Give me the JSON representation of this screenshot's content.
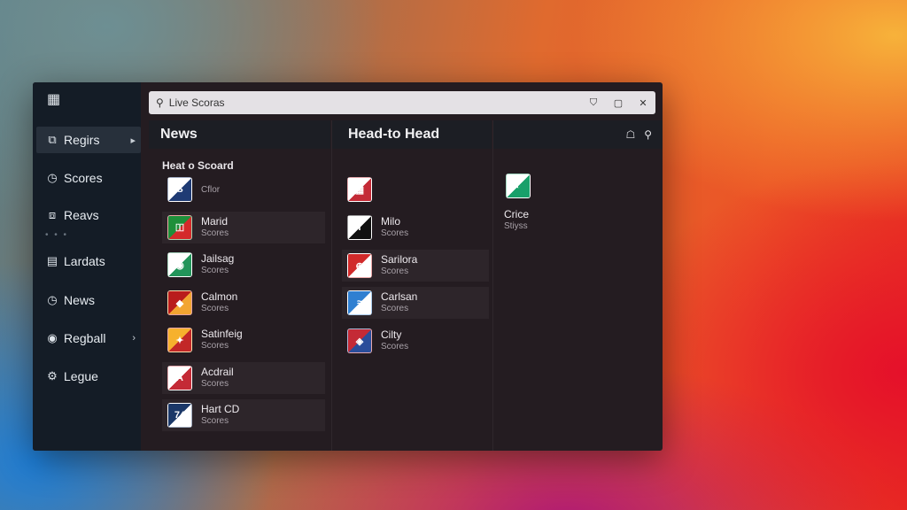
{
  "search": {
    "title": "Live Scoras"
  },
  "window_controls": {
    "pin": "⛉",
    "maximize": "▢",
    "close": "✕"
  },
  "sidebar": {
    "items": [
      {
        "label": "Regirs",
        "icon": "grid-icon",
        "glyph": "⧉",
        "active": true,
        "chevron": "▸"
      },
      {
        "label": "Scores",
        "icon": "clock-icon",
        "glyph": "◷"
      },
      {
        "label": "Reavs",
        "icon": "chart-icon",
        "glyph": "⧈"
      },
      {
        "label": "Lardats",
        "icon": "list-icon",
        "glyph": "▤"
      },
      {
        "label": "News",
        "icon": "clock-icon",
        "glyph": "◷"
      },
      {
        "label": "Regball",
        "icon": "globe-icon",
        "glyph": "◉",
        "chevron": "›"
      },
      {
        "label": "Legue",
        "icon": "settings-icon",
        "glyph": "⚙"
      }
    ],
    "dots": "• • •"
  },
  "panels": {
    "news": {
      "title": "News"
    },
    "head_to_head": {
      "title": "Head-to Head",
      "tool1": "☖",
      "tool2": "⚲"
    }
  },
  "news_section": {
    "label": "Heat o Scoard",
    "items": [
      {
        "name": "",
        "sub": "Cflor",
        "badge": "S",
        "colors": [
          "#ffffff",
          "#1f3b74"
        ]
      },
      {
        "name": "Marid",
        "sub": "Scores",
        "badge": "🇮",
        "colors": [
          "#1e8f3a",
          "#d42a2a"
        ]
      },
      {
        "name": "Jailsag",
        "sub": "Scores",
        "badge": "◉",
        "colors": [
          "#ffffff",
          "#22955a"
        ]
      },
      {
        "name": "Calmon",
        "sub": "Scores",
        "badge": "◆",
        "colors": [
          "#b91c1c",
          "#f2a531"
        ]
      },
      {
        "name": "Satinfeig",
        "sub": "Scores",
        "badge": "✦",
        "colors": [
          "#f6b12d",
          "#c22727"
        ]
      },
      {
        "name": "Acdrail",
        "sub": "Scores",
        "badge": "A",
        "colors": [
          "#ffffff",
          "#c42a36"
        ]
      },
      {
        "name": "Hart CD",
        "sub": "Scores",
        "badge": "74",
        "colors": [
          "#1b3868",
          "#ffffff"
        ]
      }
    ]
  },
  "h2h_section": {
    "items": [
      {
        "name": "",
        "sub": "",
        "badge": "▦",
        "colors": [
          "#ffffff",
          "#c42a36"
        ]
      },
      {
        "name": "Milo",
        "sub": "Scores",
        "badge": "T",
        "colors": [
          "#ffffff",
          "#111111"
        ]
      },
      {
        "name": "Sarilora",
        "sub": "Scores",
        "badge": "⊕",
        "colors": [
          "#d12a2a",
          "#ffffff"
        ]
      },
      {
        "name": "Carlsan",
        "sub": "Scores",
        "badge": "≈",
        "colors": [
          "#2f7fd1",
          "#ffffff"
        ]
      },
      {
        "name": "Cilty",
        "sub": "Scores",
        "badge": "◈",
        "colors": [
          "#c42a36",
          "#2a4d9a"
        ]
      }
    ]
  },
  "third_section": {
    "items": [
      {
        "name": "Crice",
        "sub": "Stiyss",
        "badge": "◐",
        "colors": [
          "#ffffff",
          "#18a06a"
        ]
      }
    ]
  }
}
